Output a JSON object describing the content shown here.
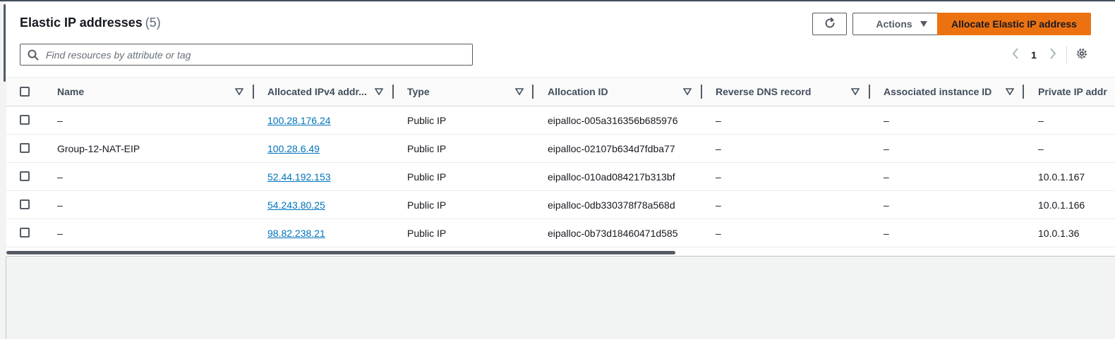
{
  "header": {
    "title": "Elastic IP addresses",
    "count": "(5)",
    "refresh_icon": "refresh-icon",
    "actions_label": "Actions",
    "allocate_label": "Allocate Elastic IP address"
  },
  "search": {
    "placeholder": "Find resources by attribute or tag",
    "icon": "search-icon"
  },
  "pagination": {
    "current_page": "1",
    "prev_icon": "chevron-left-icon",
    "next_icon": "chevron-right-icon",
    "settings_icon": "gear-icon"
  },
  "table": {
    "columns": [
      "Name",
      "Allocated IPv4 addr...",
      "Type",
      "Allocation ID",
      "Reverse DNS record",
      "Associated instance ID",
      "Private IP addr"
    ],
    "rows": [
      {
        "name": "–",
        "ip": "100.28.176.24",
        "type": "Public IP",
        "allocation_id": "eipalloc-005a316356b685976",
        "reverse_dns": "–",
        "instance_id": "–",
        "private_ip": "–"
      },
      {
        "name": "Group-12-NAT-EIP",
        "ip": "100.28.6.49",
        "type": "Public IP",
        "allocation_id": "eipalloc-02107b634d7fdba77",
        "reverse_dns": "–",
        "instance_id": "–",
        "private_ip": "–"
      },
      {
        "name": "–",
        "ip": "52.44.192.153",
        "type": "Public IP",
        "allocation_id": "eipalloc-010ad084217b313bf",
        "reverse_dns": "–",
        "instance_id": "–",
        "private_ip": "10.0.1.167"
      },
      {
        "name": "–",
        "ip": "54.243.80.25",
        "type": "Public IP",
        "allocation_id": "eipalloc-0db330378f78a568d",
        "reverse_dns": "–",
        "instance_id": "–",
        "private_ip": "10.0.1.166"
      },
      {
        "name": "–",
        "ip": "98.82.238.21",
        "type": "Public IP",
        "allocation_id": "eipalloc-0b73d18460471d585",
        "reverse_dns": "–",
        "instance_id": "–",
        "private_ip": "10.0.1.36"
      }
    ]
  },
  "colors": {
    "primary_button": "#ec7211",
    "link": "#0073bb",
    "text": "#16191f",
    "header_text": "#414d5c"
  }
}
